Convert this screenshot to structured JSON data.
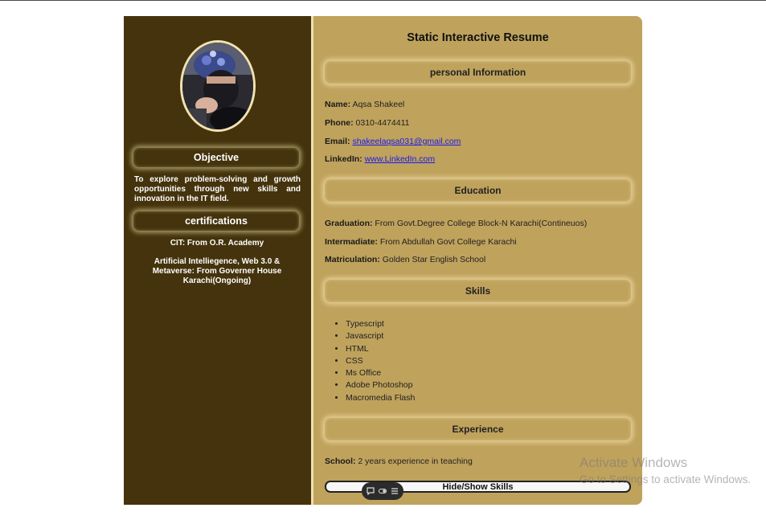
{
  "sidebar": {
    "objective_title": "Objective",
    "objective_text": "To explore problem-solving and growth opportunities through new skills and innovation in the IT field.",
    "certifications_title": "certifications",
    "certifications": [
      "CIT: From O.R. Academy",
      "Artificial Intelliegence, Web 3.0 & Metaverse: From Governer House Karachi(Ongoing)"
    ]
  },
  "main": {
    "title": "Static Interactive Resume",
    "personal": {
      "heading": "personal Information",
      "name_label": "Name:",
      "name": "Aqsa Shakeel",
      "phone_label": "Phone:",
      "phone": "0310-4474411",
      "email_label": "Email:",
      "email": "shakeelaqsa031@gmail.com",
      "linkedin_label": "LinkedIn:",
      "linkedin": "www.LinkedIn.com"
    },
    "education": {
      "heading": "Education",
      "graduation_label": "Graduation:",
      "graduation": "From Govt.Degree College Block-N Karachi(Contineuos)",
      "intermediate_label": "Intermadiate:",
      "intermediate": "From Abdullah Govt College Karachi",
      "matriculation_label": "Matriculation:",
      "matriculation": "Golden Star English School"
    },
    "skills": {
      "heading": "Skills",
      "items": [
        "Typescript",
        "Javascript",
        "HTML",
        "CSS",
        "Ms Office",
        "Adobe Photoshop",
        "Macromedia Flash"
      ]
    },
    "experience": {
      "heading": "Experience",
      "school_label": "School:",
      "school": "2 years experience in teaching"
    },
    "toggle_button": "Hide/Show Skills"
  },
  "watermark": {
    "title": "Activate Windows",
    "subtitle": "Go to Settings to activate Windows."
  },
  "colors": {
    "sidebar_bg": "#44330c",
    "main_bg": "#bfa25c",
    "link": "#1a1aee"
  }
}
